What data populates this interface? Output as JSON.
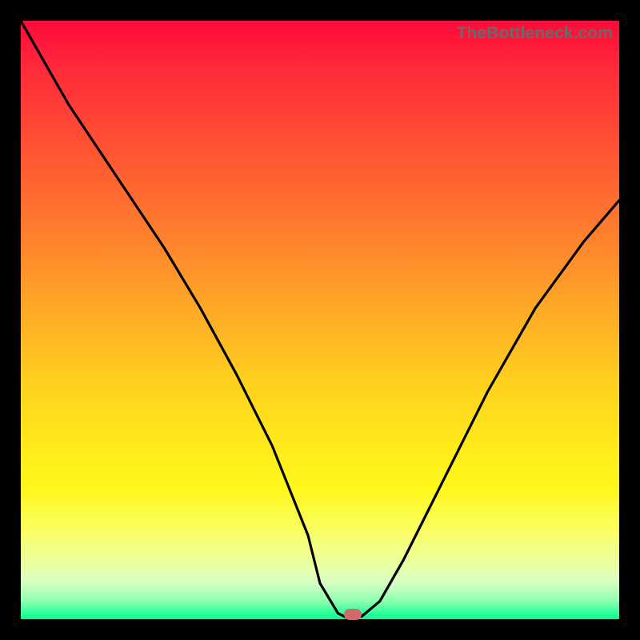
{
  "watermark": "TheBottleneck.com",
  "chart_data": {
    "type": "line",
    "title": "",
    "xlabel": "",
    "ylabel": "",
    "xlim": [
      0,
      100
    ],
    "ylim": [
      0,
      100
    ],
    "background": "rainbow-vertical",
    "series": [
      {
        "name": "bottleneck-curve",
        "x": [
          0,
          8,
          16,
          24,
          30,
          36,
          42,
          48,
          50,
          53,
          55,
          57,
          60,
          64,
          70,
          78,
          86,
          94,
          100
        ],
        "values": [
          100,
          86,
          74,
          62,
          52,
          41,
          29,
          14,
          6,
          1,
          0,
          0.5,
          3,
          10,
          22,
          38,
          52,
          63,
          70
        ]
      }
    ],
    "marker": {
      "x": 55.5,
      "y": 0.8,
      "color": "#d16a6a",
      "shape": "pill"
    }
  },
  "colors": {
    "frame": "#000000",
    "gradient_top": "#ff0a3a",
    "gradient_bottom": "#00ff90",
    "curve": "#000000",
    "marker": "#d16a6a"
  }
}
